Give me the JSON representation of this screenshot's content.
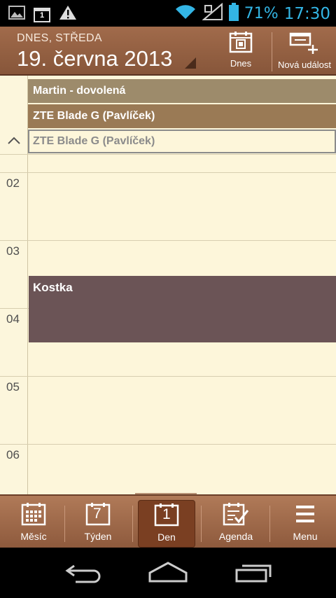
{
  "status_bar": {
    "battery": "71%",
    "time": "17:30",
    "notification_count": "1",
    "icons": [
      "image-icon",
      "calendar-notification-icon",
      "warning-icon",
      "wifi-icon",
      "signal-icon",
      "battery-icon"
    ],
    "accent": "#33b5e5"
  },
  "header": {
    "day": "DNES, STŘEDA",
    "date": "19. června 2013",
    "today_label": "Dnes",
    "new_event_label": "Nová událost",
    "bg": "#9c6646"
  },
  "allday_events": [
    {
      "title": "Martin - dovolená",
      "color": "#9d8b6b"
    },
    {
      "title": "ZTE Blade G (Pavlíček)",
      "color": "#9a7a55"
    },
    {
      "title": "ZTE Blade G (Pavlíček)",
      "color": "#fdf6da"
    }
  ],
  "hours": [
    "02",
    "03",
    "04",
    "05",
    "06"
  ],
  "events": [
    {
      "title": "Kostka",
      "color": "#6b5456"
    }
  ],
  "tabs": [
    {
      "label": "Měsíc",
      "icon": "month-icon"
    },
    {
      "label": "Týden",
      "icon": "week-icon",
      "number": "7"
    },
    {
      "label": "Den",
      "icon": "day-icon",
      "number": "1",
      "active": true
    },
    {
      "label": "Agenda",
      "icon": "agenda-icon"
    },
    {
      "label": "Menu",
      "icon": "menu-icon"
    }
  ],
  "nav": [
    "back-icon",
    "home-icon",
    "recent-apps-icon"
  ]
}
